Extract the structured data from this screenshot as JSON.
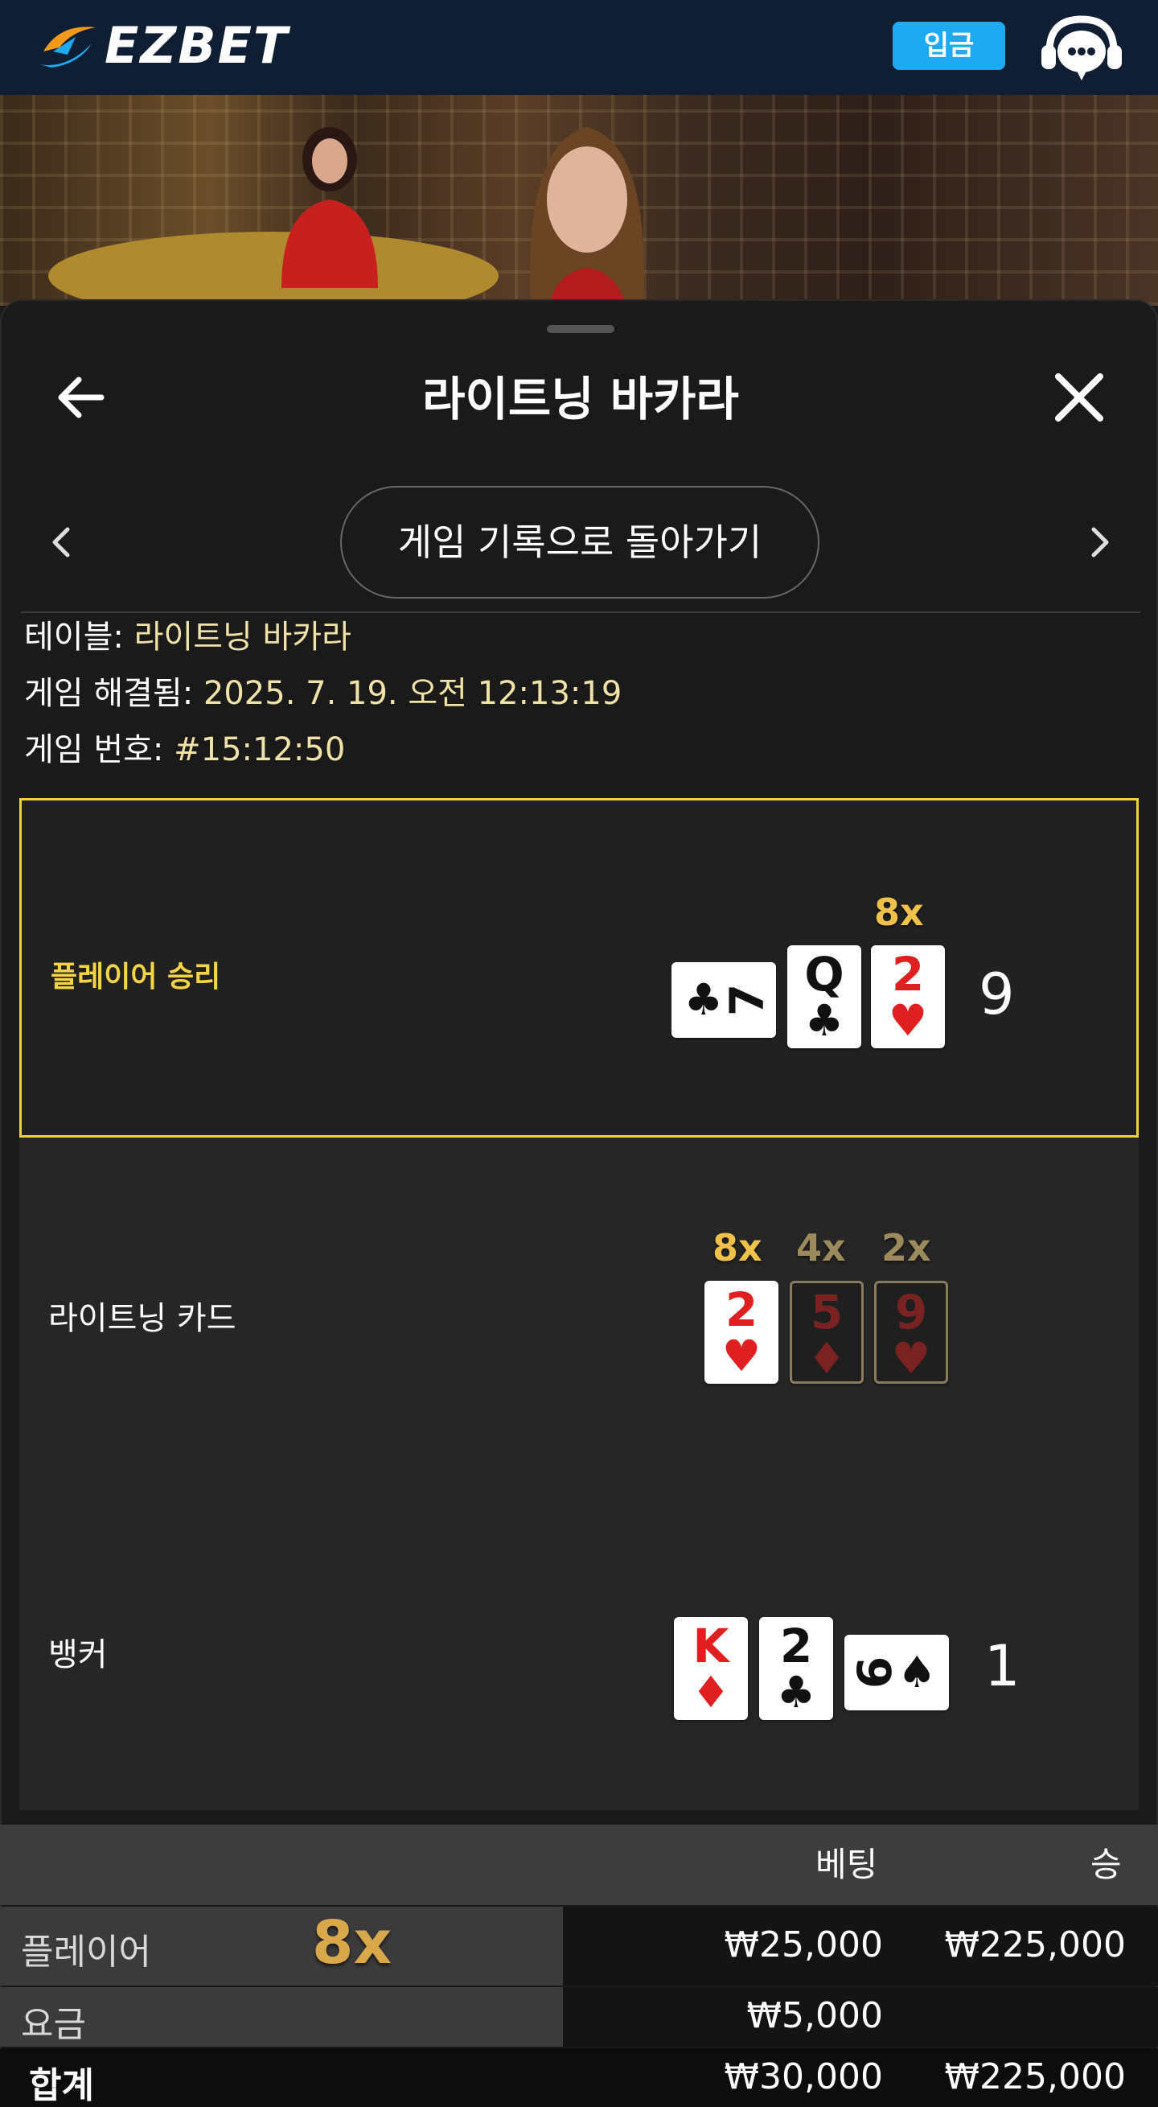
{
  "header": {
    "logo_text": "EZBET",
    "deposit_label": "입금",
    "accent_color": "#1eaaf1"
  },
  "sheet": {
    "title": "라이트닝 바카라",
    "history_button": "게임 기록으로 돌아가기"
  },
  "info": {
    "table_label": "테이블: ",
    "table_value": "라이트닝 바카라",
    "resolved_label": "게임 해결됨: ",
    "resolved_value": "2025. 7. 19. 오전 12:13:19",
    "number_label": "게임 번호: ",
    "number_value": "#15:12:50"
  },
  "results": {
    "player": {
      "label": "플레이어 승리",
      "score": "9",
      "cards": [
        {
          "rank": "7",
          "suit": "♣",
          "color": "black",
          "orientation": "sideways"
        },
        {
          "rank": "Q",
          "suit": "♣",
          "color": "black",
          "orientation": "upright"
        },
        {
          "rank": "2",
          "suit": "♥",
          "color": "red",
          "orientation": "upright",
          "multiplier": "8x"
        }
      ]
    },
    "lightning": {
      "label": "라이트닝 카드",
      "cards": [
        {
          "rank": "2",
          "suit": "♥",
          "color": "red",
          "multiplier": "8x",
          "active": true
        },
        {
          "rank": "5",
          "suit": "♦",
          "color": "red",
          "multiplier": "4x",
          "active": false
        },
        {
          "rank": "9",
          "suit": "♥",
          "color": "red",
          "multiplier": "2x",
          "active": false
        }
      ]
    },
    "banker": {
      "label": "뱅커",
      "score": "1",
      "cards": [
        {
          "rank": "K",
          "suit": "♦",
          "color": "red",
          "orientation": "upright"
        },
        {
          "rank": "2",
          "suit": "♣",
          "color": "black",
          "orientation": "upright"
        },
        {
          "rank": "9",
          "suit": "♠",
          "color": "black",
          "orientation": "sideways"
        }
      ]
    }
  },
  "bets": {
    "header_bet": "베팅",
    "header_win": "승",
    "rows": [
      {
        "label": "플레이어",
        "multiplier": "8x",
        "bet": "₩25,000",
        "win": "₩225,000"
      },
      {
        "label": "요금",
        "bet": "₩5,000",
        "win": ""
      },
      {
        "label": "합계",
        "bet": "₩30,000",
        "win": "₩225,000"
      }
    ]
  }
}
